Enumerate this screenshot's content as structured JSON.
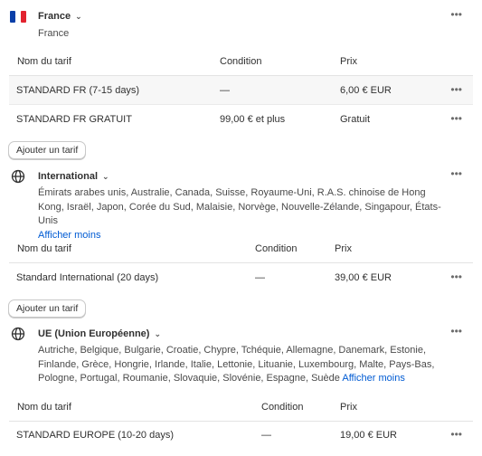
{
  "zones": [
    {
      "title": "France",
      "icon": "france-flag-icon",
      "countries": "France",
      "show_less": "",
      "columns": {
        "name": "Nom du tarif",
        "condition": "Condition",
        "price": "Prix"
      },
      "rows": [
        {
          "name": "STANDARD FR (7-15 days)",
          "condition": "—",
          "price": "6,00 € EUR"
        },
        {
          "name": "STANDARD FR GRATUIT",
          "condition": "99,00 € et plus",
          "price": "Gratuit"
        }
      ],
      "add_rate": "Ajouter un tarif"
    },
    {
      "title": "International",
      "icon": "globe-icon",
      "countries": "Émirats arabes unis, Australie, Canada, Suisse, Royaume-Uni, R.A.S. chinoise de Hong Kong, Israël, Japon, Corée du Sud, Malaisie, Norvège, Nouvelle-Zélande, Singapour, États-Unis",
      "show_less": "Afficher moins",
      "columns": {
        "name": "Nom du tarif",
        "condition": "Condition",
        "price": "Prix"
      },
      "rows": [
        {
          "name": "Standard International (20 days)",
          "condition": "—",
          "price": "39,00 € EUR"
        }
      ],
      "add_rate": "Ajouter un tarif"
    },
    {
      "title": "UE (Union Européenne)",
      "icon": "globe-icon",
      "countries": "Autriche, Belgique, Bulgarie, Croatie, Chypre, Tchéquie, Allemagne, Danemark, Estonie, Finlande, Grèce, Hongrie, Irlande, Italie, Lettonie, Lituanie, Luxembourg, Malte, Pays-Bas, Pologne, Portugal, Roumanie, Slovaquie, Slovénie, Espagne, Suède",
      "show_less": "Afficher moins",
      "columns": {
        "name": "Nom du tarif",
        "condition": "Condition",
        "price": "Prix"
      },
      "rows": [
        {
          "name": "STANDARD EUROPE (10-20 days)",
          "condition": "—",
          "price": "19,00 € EUR"
        }
      ]
    }
  ],
  "more_actions_glyph": "•••"
}
